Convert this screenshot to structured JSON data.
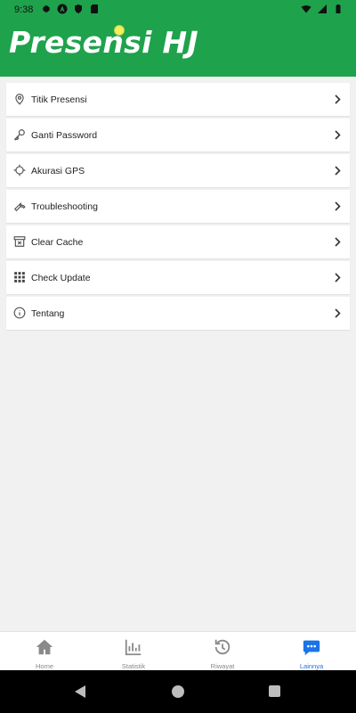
{
  "status_bar": {
    "time": "9:38"
  },
  "header": {
    "title": "Presensi HJ"
  },
  "menu": {
    "items": [
      {
        "label": "Titik Presensi",
        "icon": "location-pin-icon"
      },
      {
        "label": "Ganti Password",
        "icon": "key-icon"
      },
      {
        "label": "Akurasi GPS",
        "icon": "gps-crosshair-icon"
      },
      {
        "label": "Troubleshooting",
        "icon": "wrench-icon"
      },
      {
        "label": "Clear Cache",
        "icon": "archive-icon"
      },
      {
        "label": "Check Update",
        "icon": "grid-dots-icon"
      },
      {
        "label": "Tentang",
        "icon": "info-icon"
      }
    ]
  },
  "bottom_nav": {
    "items": [
      {
        "label": "Home",
        "icon": "home-icon",
        "active": false
      },
      {
        "label": "Statistik",
        "icon": "bar-chart-icon",
        "active": false
      },
      {
        "label": "Riwayat",
        "icon": "history-icon",
        "active": false
      },
      {
        "label": "Lainnya",
        "icon": "more-chat-icon",
        "active": true
      }
    ]
  },
  "colors": {
    "brand": "#1fa24c",
    "active_nav": "#1a73e8",
    "background": "#f1f1f1"
  }
}
